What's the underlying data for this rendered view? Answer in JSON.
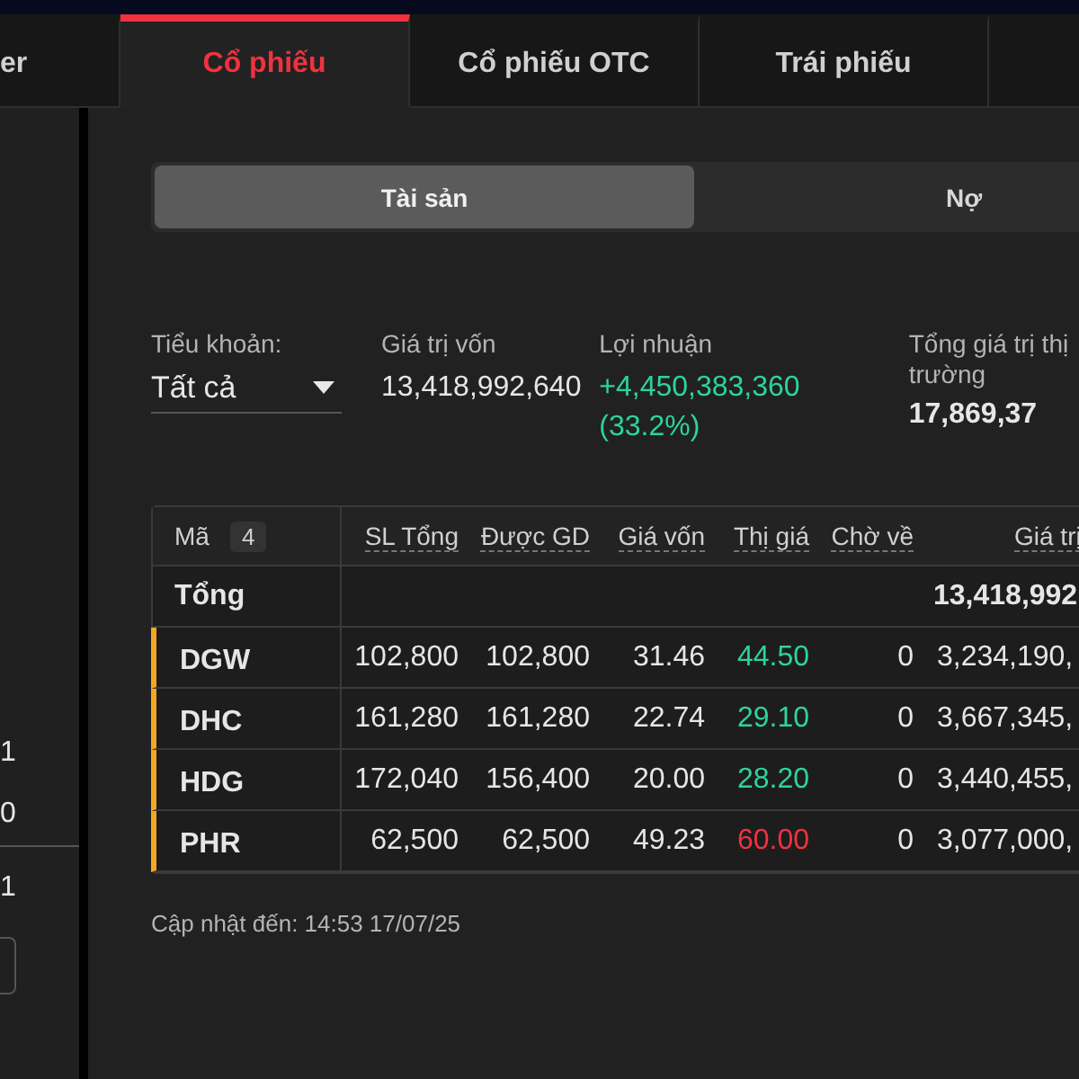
{
  "tabs": [
    {
      "label": "er",
      "selected": false
    },
    {
      "label": "Cổ phiếu",
      "selected": true
    },
    {
      "label": "Cổ phiếu OTC",
      "selected": false
    },
    {
      "label": "Trái phiếu",
      "selected": false
    }
  ],
  "sidebar": {
    "values": [
      "1",
      "0",
      "1"
    ]
  },
  "segments": [
    {
      "label": "Tài sản",
      "selected": true
    },
    {
      "label": "Nợ",
      "selected": false
    }
  ],
  "summary": {
    "account_label": "Tiểu khoản:",
    "account_value": "Tất cả",
    "capital_label": "Giá trị vốn",
    "capital_value": "13,418,992,640",
    "profit_label": "Lợi nhuận",
    "profit_value": "+4,450,383,360",
    "profit_percent": "(33.2%)",
    "market_label": "Tổng giá trị thị trường",
    "market_value": "17,869,37"
  },
  "table": {
    "code_label": "Mã",
    "count": "4",
    "columns": [
      "SL Tổng",
      "Được GD",
      "Giá vốn",
      "Thị giá",
      "Chờ về",
      "Giá trị"
    ],
    "total": {
      "label": "Tổng",
      "value": "13,418,992,"
    },
    "rows": [
      {
        "code": "DGW",
        "total": "102,800",
        "tradable": "102,800",
        "cost": "31.46",
        "price": "44.50",
        "color": "#2ed39a",
        "pending": "0",
        "value": "3,234,190,"
      },
      {
        "code": "DHC",
        "total": "161,280",
        "tradable": "161,280",
        "cost": "22.74",
        "price": "29.10",
        "color": "#2ed39a",
        "pending": "0",
        "value": "3,667,345,"
      },
      {
        "code": "HDG",
        "total": "172,040",
        "tradable": "156,400",
        "cost": "20.00",
        "price": "28.20",
        "color": "#2ed39a",
        "pending": "0",
        "value": "3,440,455,"
      },
      {
        "code": "PHR",
        "total": "62,500",
        "tradable": "62,500",
        "cost": "49.23",
        "price": "60.00",
        "color": "#f0323f",
        "pending": "0",
        "value": "3,077,000,"
      }
    ]
  },
  "updated": "Cập nhật đến: 14:53 17/07/25"
}
